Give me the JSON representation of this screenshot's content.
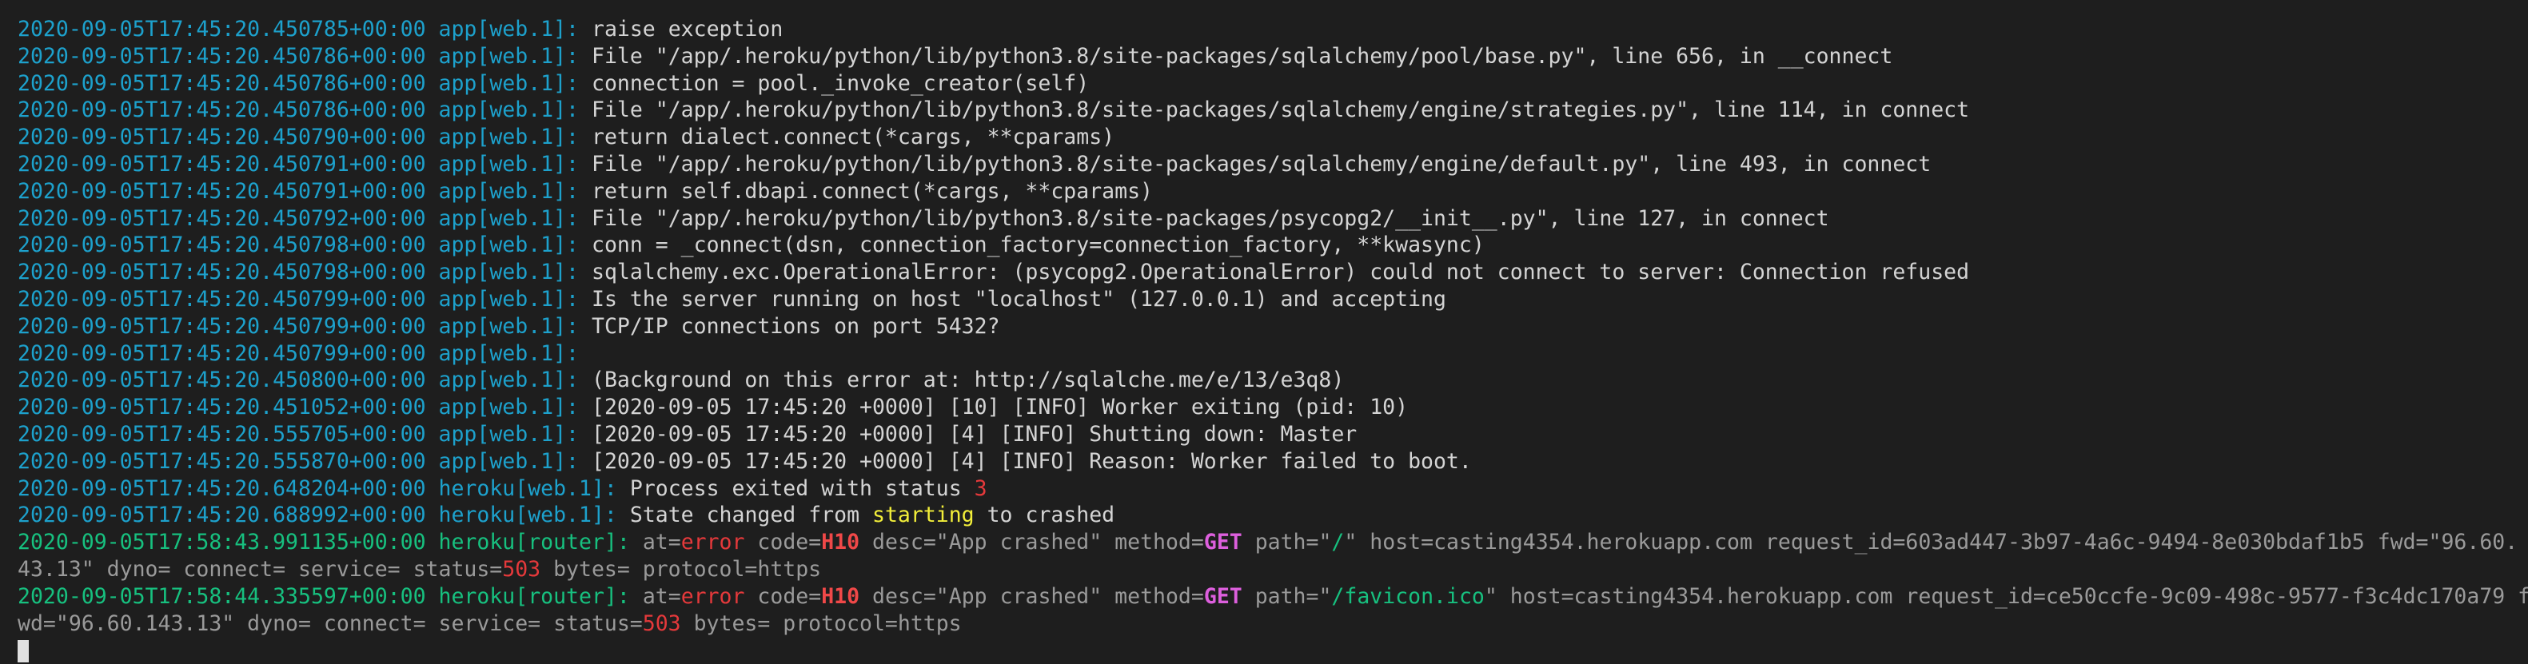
{
  "palette": {
    "app": "#1da1cc",
    "router": "#17c07f",
    "msg": "#d4d4d4",
    "dim": "#9a9a9a",
    "err": "#e5393b",
    "code": "#f04848",
    "method": "#dd5fdd",
    "ok": "#17c07f",
    "warn": "#f2ee3a"
  },
  "lines": [
    {
      "ts": "2020-09-05T17:45:20.450785+00:00",
      "src": "app[web.1]:",
      "kind": "app",
      "parts": [
        {
          "t": "raise exception",
          "c": "msg"
        }
      ]
    },
    {
      "ts": "2020-09-05T17:45:20.450786+00:00",
      "src": "app[web.1]:",
      "kind": "app",
      "parts": [
        {
          "t": "File \"/app/.heroku/python/lib/python3.8/site-packages/sqlalchemy/pool/base.py\", line 656, in __connect",
          "c": "msg"
        }
      ]
    },
    {
      "ts": "2020-09-05T17:45:20.450786+00:00",
      "src": "app[web.1]:",
      "kind": "app",
      "parts": [
        {
          "t": "connection = pool._invoke_creator(self)",
          "c": "msg"
        }
      ]
    },
    {
      "ts": "2020-09-05T17:45:20.450786+00:00",
      "src": "app[web.1]:",
      "kind": "app",
      "parts": [
        {
          "t": "File \"/app/.heroku/python/lib/python3.8/site-packages/sqlalchemy/engine/strategies.py\", line 114, in connect",
          "c": "msg"
        }
      ]
    },
    {
      "ts": "2020-09-05T17:45:20.450790+00:00",
      "src": "app[web.1]:",
      "kind": "app",
      "parts": [
        {
          "t": "return dialect.connect(*cargs, **cparams)",
          "c": "msg"
        }
      ]
    },
    {
      "ts": "2020-09-05T17:45:20.450791+00:00",
      "src": "app[web.1]:",
      "kind": "app",
      "parts": [
        {
          "t": "File \"/app/.heroku/python/lib/python3.8/site-packages/sqlalchemy/engine/default.py\", line 493, in connect",
          "c": "msg"
        }
      ]
    },
    {
      "ts": "2020-09-05T17:45:20.450791+00:00",
      "src": "app[web.1]:",
      "kind": "app",
      "parts": [
        {
          "t": "return self.dbapi.connect(*cargs, **cparams)",
          "c": "msg"
        }
      ]
    },
    {
      "ts": "2020-09-05T17:45:20.450792+00:00",
      "src": "app[web.1]:",
      "kind": "app",
      "parts": [
        {
          "t": "File \"/app/.heroku/python/lib/python3.8/site-packages/psycopg2/__init__.py\", line 127, in connect",
          "c": "msg"
        }
      ]
    },
    {
      "ts": "2020-09-05T17:45:20.450798+00:00",
      "src": "app[web.1]:",
      "kind": "app",
      "parts": [
        {
          "t": "conn = _connect(dsn, connection_factory=connection_factory, **kwasync)",
          "c": "msg"
        }
      ]
    },
    {
      "ts": "2020-09-05T17:45:20.450798+00:00",
      "src": "app[web.1]:",
      "kind": "app",
      "parts": [
        {
          "t": "sqlalchemy.exc.OperationalError: (psycopg2.OperationalError) could not connect to server: Connection refused",
          "c": "msg"
        }
      ]
    },
    {
      "ts": "2020-09-05T17:45:20.450799+00:00",
      "src": "app[web.1]:",
      "kind": "app",
      "parts": [
        {
          "t": "Is the server running on host \"localhost\" (127.0.0.1) and accepting",
          "c": "msg"
        }
      ]
    },
    {
      "ts": "2020-09-05T17:45:20.450799+00:00",
      "src": "app[web.1]:",
      "kind": "app",
      "parts": [
        {
          "t": "TCP/IP connections on port 5432?",
          "c": "msg"
        }
      ]
    },
    {
      "ts": "2020-09-05T17:45:20.450799+00:00",
      "src": "app[web.1]:",
      "kind": "app",
      "parts": []
    },
    {
      "ts": "2020-09-05T17:45:20.450800+00:00",
      "src": "app[web.1]:",
      "kind": "app",
      "parts": [
        {
          "t": "(Background on this error at: http://sqlalche.me/e/13/e3q8)",
          "c": "msg"
        }
      ]
    },
    {
      "ts": "2020-09-05T17:45:20.451052+00:00",
      "src": "app[web.1]:",
      "kind": "app",
      "parts": [
        {
          "t": "[2020-09-05 17:45:20 +0000] [10] [INFO] Worker exiting (pid: 10)",
          "c": "msg"
        }
      ]
    },
    {
      "ts": "2020-09-05T17:45:20.555705+00:00",
      "src": "app[web.1]:",
      "kind": "app",
      "parts": [
        {
          "t": "[2020-09-05 17:45:20 +0000] [4] [INFO] Shutting down: Master",
          "c": "msg"
        }
      ]
    },
    {
      "ts": "2020-09-05T17:45:20.555870+00:00",
      "src": "app[web.1]:",
      "kind": "app",
      "parts": [
        {
          "t": "[2020-09-05 17:45:20 +0000] [4] [INFO] Reason: Worker failed to boot.",
          "c": "msg"
        }
      ]
    },
    {
      "ts": "2020-09-05T17:45:20.648204+00:00",
      "src": "heroku[web.1]:",
      "kind": "app",
      "parts": [
        {
          "t": "Process exited with status ",
          "c": "msg"
        },
        {
          "t": "3",
          "c": "err"
        }
      ]
    },
    {
      "ts": "2020-09-05T17:45:20.688992+00:00",
      "src": "heroku[web.1]:",
      "kind": "app",
      "parts": [
        {
          "t": "State changed from ",
          "c": "msg"
        },
        {
          "t": "starting",
          "c": "warn"
        },
        {
          "t": " to crashed",
          "c": "msg"
        }
      ]
    },
    {
      "ts": "2020-09-05T17:58:43.991135+00:00",
      "src": "heroku[router]:",
      "kind": "router",
      "parts": [
        {
          "t": "at=",
          "c": "dim"
        },
        {
          "t": "error",
          "c": "err"
        },
        {
          "t": " code=",
          "c": "dim"
        },
        {
          "t": "H10",
          "c": "code",
          "b": true
        },
        {
          "t": " desc=\"App crashed\" method=",
          "c": "dim"
        },
        {
          "t": "GET",
          "c": "method",
          "b": true
        },
        {
          "t": " path=\"",
          "c": "dim"
        },
        {
          "t": "/",
          "c": "ok"
        },
        {
          "t": "\" host=casting4354.herokuapp.com request_id=603ad447-3b97-4a6c-9494-8e030bdaf1b5 fwd=\"96.60.",
          "c": "dim"
        },
        {
          "br": true
        },
        {
          "t": "43.13\" dyno= connect= service= status=",
          "c": "dim"
        },
        {
          "t": "503",
          "c": "err"
        },
        {
          "t": " bytes= protocol=https",
          "c": "dim"
        }
      ]
    },
    {
      "ts": "2020-09-05T17:58:44.335597+00:00",
      "src": "heroku[router]:",
      "kind": "router",
      "parts": [
        {
          "t": "at=",
          "c": "dim"
        },
        {
          "t": "error",
          "c": "err"
        },
        {
          "t": " code=",
          "c": "dim"
        },
        {
          "t": "H10",
          "c": "code",
          "b": true
        },
        {
          "t": " desc=\"App crashed\" method=",
          "c": "dim"
        },
        {
          "t": "GET",
          "c": "method",
          "b": true
        },
        {
          "t": " path=\"",
          "c": "dim"
        },
        {
          "t": "/favicon.ico",
          "c": "ok"
        },
        {
          "t": "\" host=casting4354.herokuapp.com request_id=ce50ccfe-9c09-498c-9577-f3c4dc170a79 f",
          "c": "dim"
        },
        {
          "br": true
        },
        {
          "t": "wd=\"96.60.143.13\" dyno= connect= service= status=",
          "c": "dim"
        },
        {
          "t": "503",
          "c": "err"
        },
        {
          "t": " bytes= protocol=https",
          "c": "dim"
        }
      ]
    }
  ]
}
